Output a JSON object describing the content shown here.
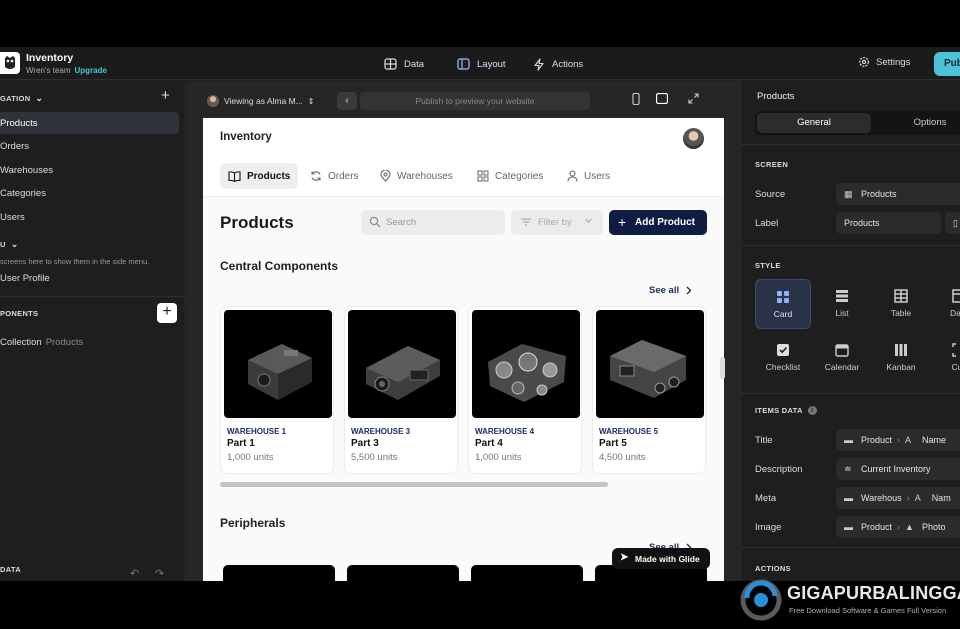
{
  "app": {
    "name": "Inventory",
    "team": "Wren's team",
    "upgrade_label": "Upgrade"
  },
  "topbar": {
    "tabs": [
      {
        "label": "Data",
        "icon": "table-icon"
      },
      {
        "label": "Layout",
        "icon": "layout-icon"
      },
      {
        "label": "Actions",
        "icon": "bolt-icon"
      }
    ],
    "settings_label": "Settings",
    "publish_label": "Pub"
  },
  "left_sidebar": {
    "navigation_header": "GATION",
    "nav_items": [
      "Products",
      "Orders",
      "Warehouses",
      "Categories",
      "Users"
    ],
    "menu_header": "U",
    "menu_hint": "screens here to show them in the side menu.",
    "menu_items": [
      "User Profile"
    ],
    "components_header": "PONENTS",
    "collection_label": "Collection",
    "collection_source": "Products",
    "data_header": "DATA"
  },
  "preview": {
    "viewing_as": "Viewing as Alma M...",
    "url_placeholder": "Publish to preview your website",
    "page": {
      "app_title": "Inventory",
      "tabs": [
        {
          "label": "Products",
          "icon": "book-icon",
          "active": true
        },
        {
          "label": "Orders",
          "icon": "refresh-icon",
          "active": false
        },
        {
          "label": "Warehouses",
          "icon": "map-pin-icon",
          "active": false
        },
        {
          "label": "Categories",
          "icon": "grid-icon",
          "active": false
        },
        {
          "label": "Users",
          "icon": "user-icon",
          "active": false
        }
      ],
      "heading": "Products",
      "search_placeholder": "Search",
      "filter_label": "Filter by",
      "add_button": "Add Product",
      "sections": [
        {
          "title": "Central Components",
          "see_all": "See all",
          "cards": [
            {
              "warehouse": "WAREHOUSE 1",
              "part": "Part 1",
              "units": "1,000 units"
            },
            {
              "warehouse": "WAREHOUSE 3",
              "part": "Part 3",
              "units": "5,500 units"
            },
            {
              "warehouse": "WAREHOUSE 4",
              "part": "Part 4",
              "units": "1,000 units"
            },
            {
              "warehouse": "WAREHOUSE 5",
              "part": "Part 5",
              "units": "4,500 units"
            }
          ]
        },
        {
          "title": "Peripherals",
          "see_all": "See all"
        }
      ],
      "made_with": "Made with Glide"
    }
  },
  "right_panel": {
    "title": "Products",
    "tabs": [
      "General",
      "Options"
    ],
    "screen_header": "SCREEN",
    "source_label": "Source",
    "source_value": "Products",
    "label_label": "Label",
    "label_value": "Products",
    "style_header": "STYLE",
    "style_options": [
      "Card",
      "List",
      "Table",
      "Data",
      "Checklist",
      "Calendar",
      "Kanban",
      "Cus"
    ],
    "items_data_header": "ITEMS DATA",
    "items": [
      {
        "label": "Title",
        "source": "Product",
        "field": "Name"
      },
      {
        "label": "Description",
        "source": "Current Inventory",
        "field": ""
      },
      {
        "label": "Meta",
        "source": "Warehous",
        "field": "Nam"
      },
      {
        "label": "Image",
        "source": "Product",
        "field": "Photo"
      }
    ],
    "actions_header": "ACTIONS"
  },
  "watermark": {
    "title": "GIGAPURBALINGGA",
    "subtitle": "Free Download Software & Games Full Version"
  }
}
